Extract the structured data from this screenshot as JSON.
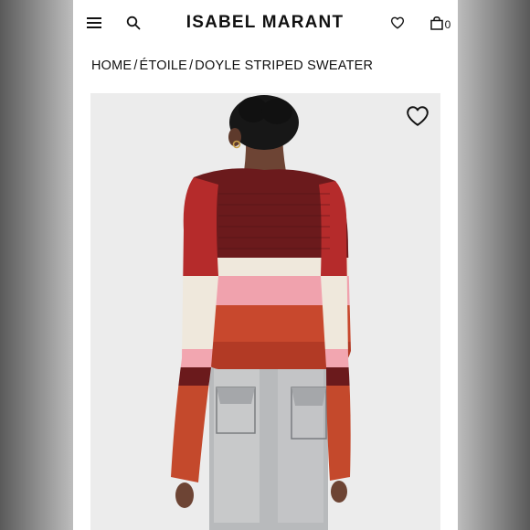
{
  "header": {
    "brand": "ISABEL MARANT",
    "cart_count": "0"
  },
  "breadcrumb": {
    "items": [
      "HOME",
      "ÉTOILE",
      "DOYLE STRIPED SWEATER"
    ],
    "separator": "/"
  },
  "icons": {
    "menu": "hamburger-menu-icon",
    "search": "search-icon",
    "wishlist": "heart-icon",
    "cart": "shopping-bag-icon",
    "favorite": "heart-outline-icon"
  },
  "colors": {
    "background": "#ffffff",
    "text": "#111111",
    "image_bg": "#ececec"
  }
}
